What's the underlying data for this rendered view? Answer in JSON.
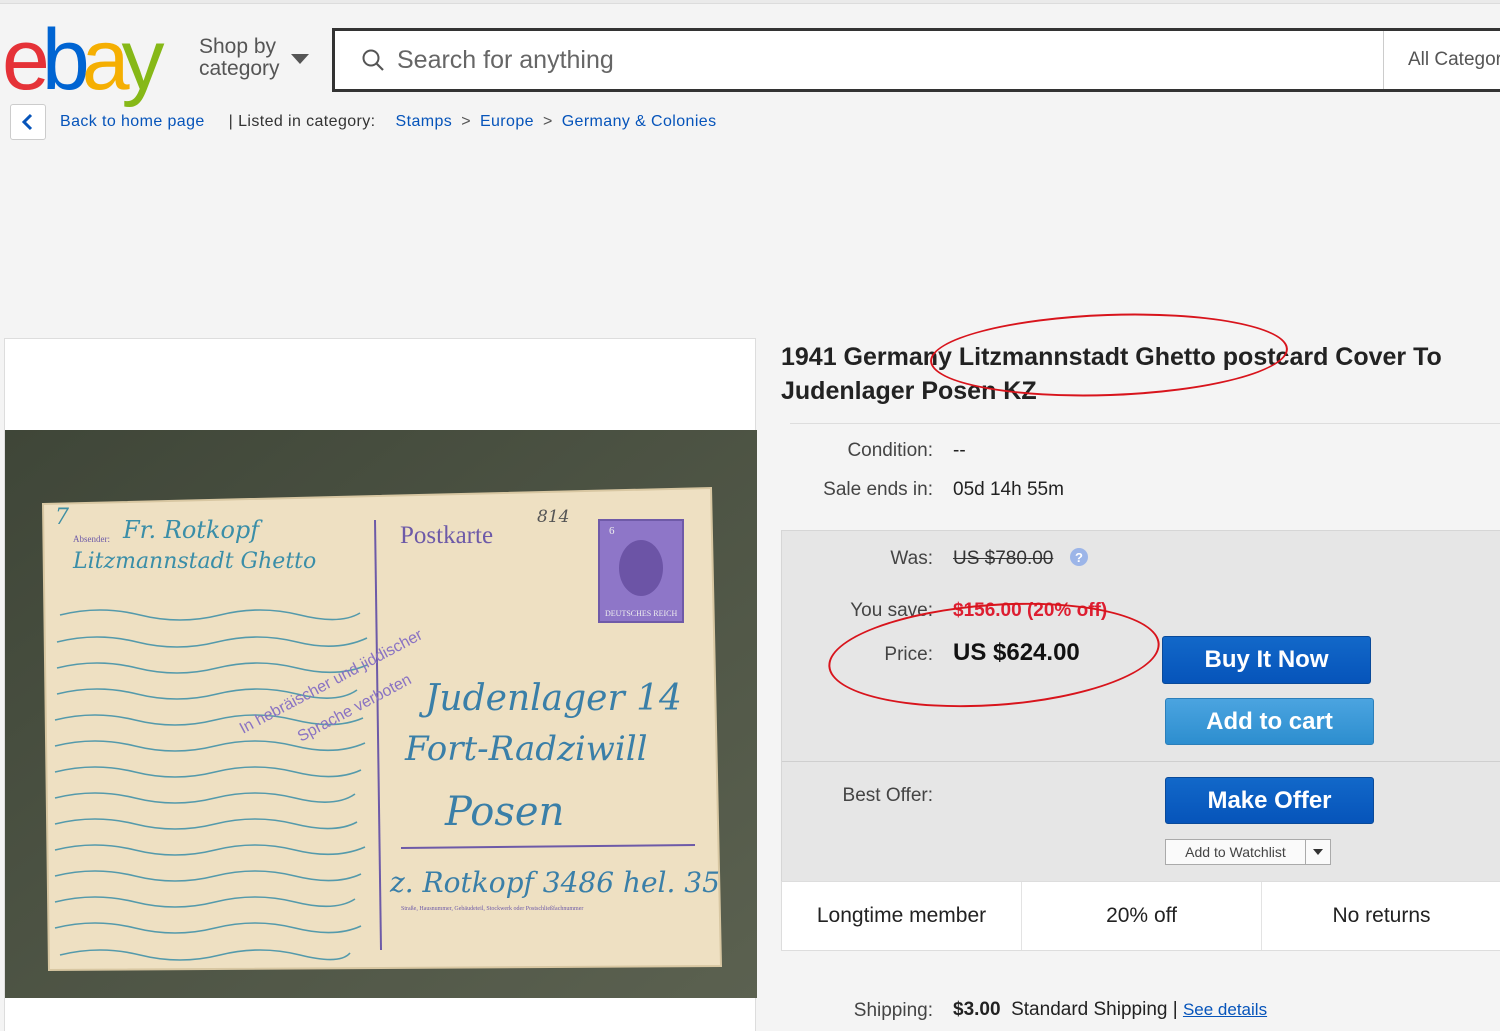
{
  "header": {
    "logo_text": "ebay",
    "shop_by_category": "Shop by category",
    "search_placeholder": "Search for anything",
    "category_select": "All Categori"
  },
  "breadcrumb": {
    "back_label": "Back to home page",
    "listed_in": "| Listed in category:",
    "items": [
      "Stamps",
      "Europe",
      "Germany & Colonies"
    ],
    "separator": ">"
  },
  "listing": {
    "title_line1": "1941 Germany Litzmannstadt Ghetto postcard Cover To",
    "title_line2": "Judenlager Posen KZ",
    "condition_label": "Condition:",
    "condition_value": "--",
    "sale_ends_label": "Sale ends in:",
    "sale_ends_value": "05d 14h 55m",
    "was_label": "Was:",
    "was_value": "US $780.00",
    "you_save_label": "You save:",
    "you_save_value": "$156.00 (20% off)",
    "price_label": "Price:",
    "price_value": "US $624.00",
    "buy_it_now": "Buy It Now",
    "add_to_cart": "Add to cart",
    "best_offer_label": "Best Offer:",
    "make_offer": "Make Offer",
    "add_to_watchlist": "Add to Watchlist",
    "badges": [
      "Longtime member",
      "20% off",
      "No returns"
    ],
    "shipping_label": "Shipping:",
    "shipping_amount": "$3.00",
    "shipping_method": "Standard Shipping |",
    "see_details": "See details"
  },
  "postcard": {
    "heading": "Postkarte",
    "stamp_value": "6",
    "stamp_caption": "DEUTSCHES REICH",
    "number": "814",
    "corner_mark": "7",
    "sender_label": "Absender:",
    "sender_name": "Fr. Rotkopf",
    "sender_place": "Litzmannstadt Ghetto",
    "stamp_line1": "In hebräischer und jiddischer",
    "stamp_line2": "Sprache verboten",
    "address_line1": "Judenlager 14",
    "address_line2": "Fort-Radziwill",
    "address_line3": "Posen",
    "address_line4": "z. Rotkopf 3486 hel. 35",
    "footer_small": "Straße, Hausnummer, Gebäudeteil, Stockwerk oder Postschließfachnummer"
  },
  "colors": {
    "link": "#0654ba",
    "buy_button": "#0654ba",
    "cart_button": "#2d8ecf",
    "save_red": "#dd1e31",
    "annotation_red": "#d8141c"
  }
}
